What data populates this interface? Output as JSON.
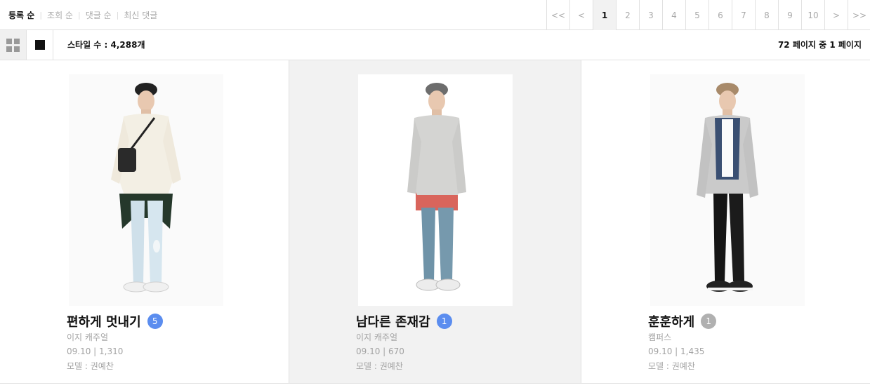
{
  "sort": [
    {
      "label": "등록 순",
      "active": true
    },
    {
      "label": "조회 순",
      "active": false
    },
    {
      "label": "댓글 순",
      "active": false
    },
    {
      "label": "최신 댓글",
      "active": false
    }
  ],
  "pager": {
    "first": "<<",
    "prev": "<",
    "pages": [
      "1",
      "2",
      "3",
      "4",
      "5",
      "6",
      "7",
      "8",
      "9",
      "10"
    ],
    "current": "1",
    "next": ">",
    "last": ">>"
  },
  "toolbar": {
    "style_count": "스타일 수 : 4,288개",
    "page_info": "72 페이지 중 1 페이지",
    "grid_view_icon": "grid-icon",
    "single_view_icon": "square-icon"
  },
  "cards": [
    {
      "title": "편하게 멋내기",
      "comments": "5",
      "badge_color": "#5b8def",
      "category": "이지 캐주얼",
      "stats": "09.10 | 1,310",
      "model": "모델 : 권예찬",
      "highlighted": false
    },
    {
      "title": "남다른 존재감",
      "comments": "1",
      "badge_color": "#5b8def",
      "category": "이지 캐주얼",
      "stats": "09.10 | 670",
      "model": "모델 : 권예찬",
      "highlighted": true
    },
    {
      "title": "훈훈하게",
      "comments": "1",
      "badge_color": "#b0b0b0",
      "category": "캠퍼스",
      "stats": "09.10 | 1,435",
      "model": "모델 : 권예찬",
      "highlighted": false
    }
  ]
}
